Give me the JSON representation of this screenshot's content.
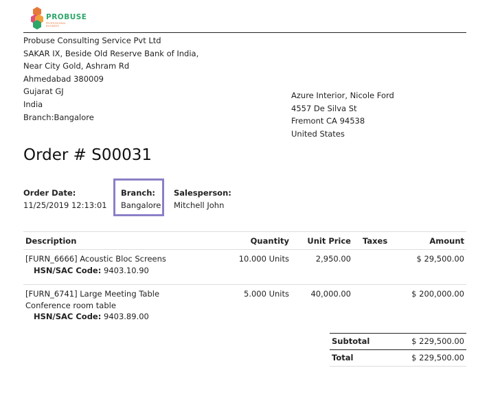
{
  "logo": {
    "text": "PROBUSE",
    "tagline": "PROFESSIONAL BUSINESS",
    "colors": {
      "orange": "#e6793a",
      "green": "#2ea66a",
      "pink": "#e04f7a"
    }
  },
  "company": {
    "lines": [
      "Probuse Consulting Service Pvt Ltd",
      "SAKAR IX, Beside Old Reserve Bank of India,",
      "Near City Gold, Ashram Rd",
      "Ahmedabad 380009",
      "Gujarat GJ",
      "India",
      "Branch:Bangalore"
    ]
  },
  "customer": {
    "lines": [
      "Azure Interior, Nicole Ford",
      "4557 De Silva St",
      "Fremont CA 94538",
      "United States"
    ]
  },
  "order": {
    "title": "Order # S00031",
    "date_label": "Order Date:",
    "date_value": "11/25/2019 12:13:01",
    "branch_label": "Branch:",
    "branch_value": "Bangalore",
    "salesperson_label": "Salesperson:",
    "salesperson_value": "Mitchell John"
  },
  "table": {
    "headers": {
      "description": "Description",
      "quantity": "Quantity",
      "unit_price": "Unit Price",
      "taxes": "Taxes",
      "amount": "Amount"
    },
    "rows": [
      {
        "description": "[FURN_6666] Acoustic Bloc Screens",
        "extra": "",
        "hsn_label": "HSN/SAC Code:",
        "hsn_value": " 9403.10.90",
        "quantity": "10.000 Units",
        "unit_price": "2,950.00",
        "taxes": "",
        "amount": "$ 29,500.00"
      },
      {
        "description": "[FURN_6741] Large Meeting Table",
        "extra": "Conference room table",
        "hsn_label": "HSN/SAC Code:",
        "hsn_value": " 9403.89.00",
        "quantity": "5.000 Units",
        "unit_price": "40,000.00",
        "taxes": "",
        "amount": "$ 200,000.00"
      }
    ]
  },
  "totals": {
    "subtotal_label": "Subtotal",
    "subtotal_value": "$ 229,500.00",
    "total_label": "Total",
    "total_value": "$ 229,500.00"
  },
  "colors": {
    "highlight_border": "#8b7fc7",
    "rule": "#222222",
    "light_rule": "#dddddd"
  }
}
